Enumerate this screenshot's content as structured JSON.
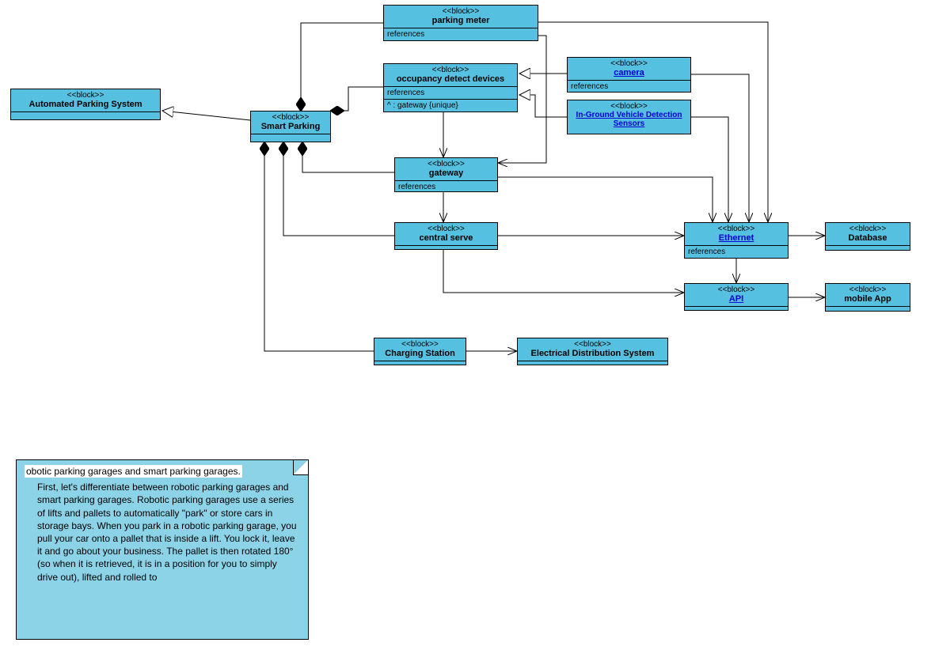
{
  "blocks": {
    "automated": {
      "stereo": "<<block>>",
      "title": "Automated Parking System"
    },
    "smart": {
      "stereo": "<<block>>",
      "title": "Smart Parking"
    },
    "meter": {
      "stereo": "<<block>>",
      "title": "parking meter",
      "section1": "references"
    },
    "occupancy": {
      "stereo": "<<block>>",
      "title": "occupancy detect devices",
      "section1": "references",
      "section2": "^ : gateway {unique}"
    },
    "camera": {
      "stereo": "<<block>>",
      "title": "camera",
      "section1": "references"
    },
    "sensors": {
      "stereo": "<<block>>",
      "title": "In-Ground Vehicle Detection Sensors"
    },
    "gateway": {
      "stereo": "<<block>>",
      "title": "gateway",
      "section1": "references"
    },
    "central": {
      "stereo": "<<block>>",
      "title": "central serve"
    },
    "ethernet": {
      "stereo": "<<block>>",
      "title": "Ethernet",
      "section1": "references"
    },
    "database": {
      "stereo": "<<block>>",
      "title": "Database"
    },
    "api": {
      "stereo": "<<block>>",
      "title": "API"
    },
    "mobile": {
      "stereo": "<<block>>",
      "title": "mobile App"
    },
    "charging": {
      "stereo": "<<block>>",
      "title": "Charging Station"
    },
    "eds": {
      "stereo": "<<block>>",
      "title": "Electrical Distribution System"
    }
  },
  "note": {
    "title": "obotic parking garages and smart parking garages.",
    "body": "First, let's differentiate between robotic parking garages and smart parking garages. Robotic parking garages use a series of lifts and pallets to automatically \"park\" or store cars in storage bays. When you park in a robotic parking garage, you pull your car onto a pallet that is inside a lift. You lock it, leave it and go about your business. The pallet is then rotated 180° (so when it is retrieved, it is in a position for you to simply drive out), lifted and rolled to"
  },
  "chart_data": {
    "type": "table",
    "description": "SysML-style block definition diagram of an Automated / Smart Parking System",
    "blocks": [
      "Automated Parking System",
      "Smart Parking",
      "parking meter",
      "occupancy detect devices",
      "camera",
      "In-Ground Vehicle Detection Sensors",
      "gateway",
      "central serve",
      "Ethernet",
      "Database",
      "API",
      "mobile App",
      "Charging Station",
      "Electrical Distribution System"
    ],
    "relationships": [
      {
        "from": "Smart Parking",
        "to": "Automated Parking System",
        "type": "generalization"
      },
      {
        "from": "Smart Parking",
        "to": "parking meter",
        "type": "composition"
      },
      {
        "from": "parking meter",
        "to": "Ethernet",
        "type": "association-arrow"
      },
      {
        "from": "Smart Parking",
        "to": "occupancy detect devices",
        "type": "composition"
      },
      {
        "from": "camera",
        "to": "occupancy detect devices",
        "type": "generalization"
      },
      {
        "from": "In-Ground Vehicle Detection Sensors",
        "to": "occupancy detect devices",
        "type": "generalization"
      },
      {
        "from": "camera",
        "to": "Ethernet",
        "type": "association-arrow"
      },
      {
        "from": "In-Ground Vehicle Detection Sensors",
        "to": "Ethernet",
        "type": "association-arrow"
      },
      {
        "from": "occupancy detect devices",
        "to": "gateway",
        "type": "association-arrow"
      },
      {
        "from": "parking meter",
        "to": "gateway",
        "type": "association-arrow"
      },
      {
        "from": "Smart Parking",
        "to": "gateway",
        "type": "composition"
      },
      {
        "from": "gateway",
        "to": "central serve",
        "type": "association-arrow"
      },
      {
        "from": "Smart Parking",
        "to": "central serve",
        "type": "composition"
      },
      {
        "from": "central serve",
        "to": "Ethernet",
        "type": "association-arrow"
      },
      {
        "from": "gateway",
        "to": "Ethernet",
        "type": "association-arrow"
      },
      {
        "from": "Ethernet",
        "to": "Database",
        "type": "association-arrow"
      },
      {
        "from": "Ethernet",
        "to": "API",
        "type": "association-arrow"
      },
      {
        "from": "central serve",
        "to": "API",
        "type": "association-arrow"
      },
      {
        "from": "API",
        "to": "mobile App",
        "type": "association-arrow"
      },
      {
        "from": "Smart Parking",
        "to": "Charging Station",
        "type": "composition"
      },
      {
        "from": "Charging Station",
        "to": "Electrical Distribution System",
        "type": "association-arrow"
      }
    ]
  }
}
